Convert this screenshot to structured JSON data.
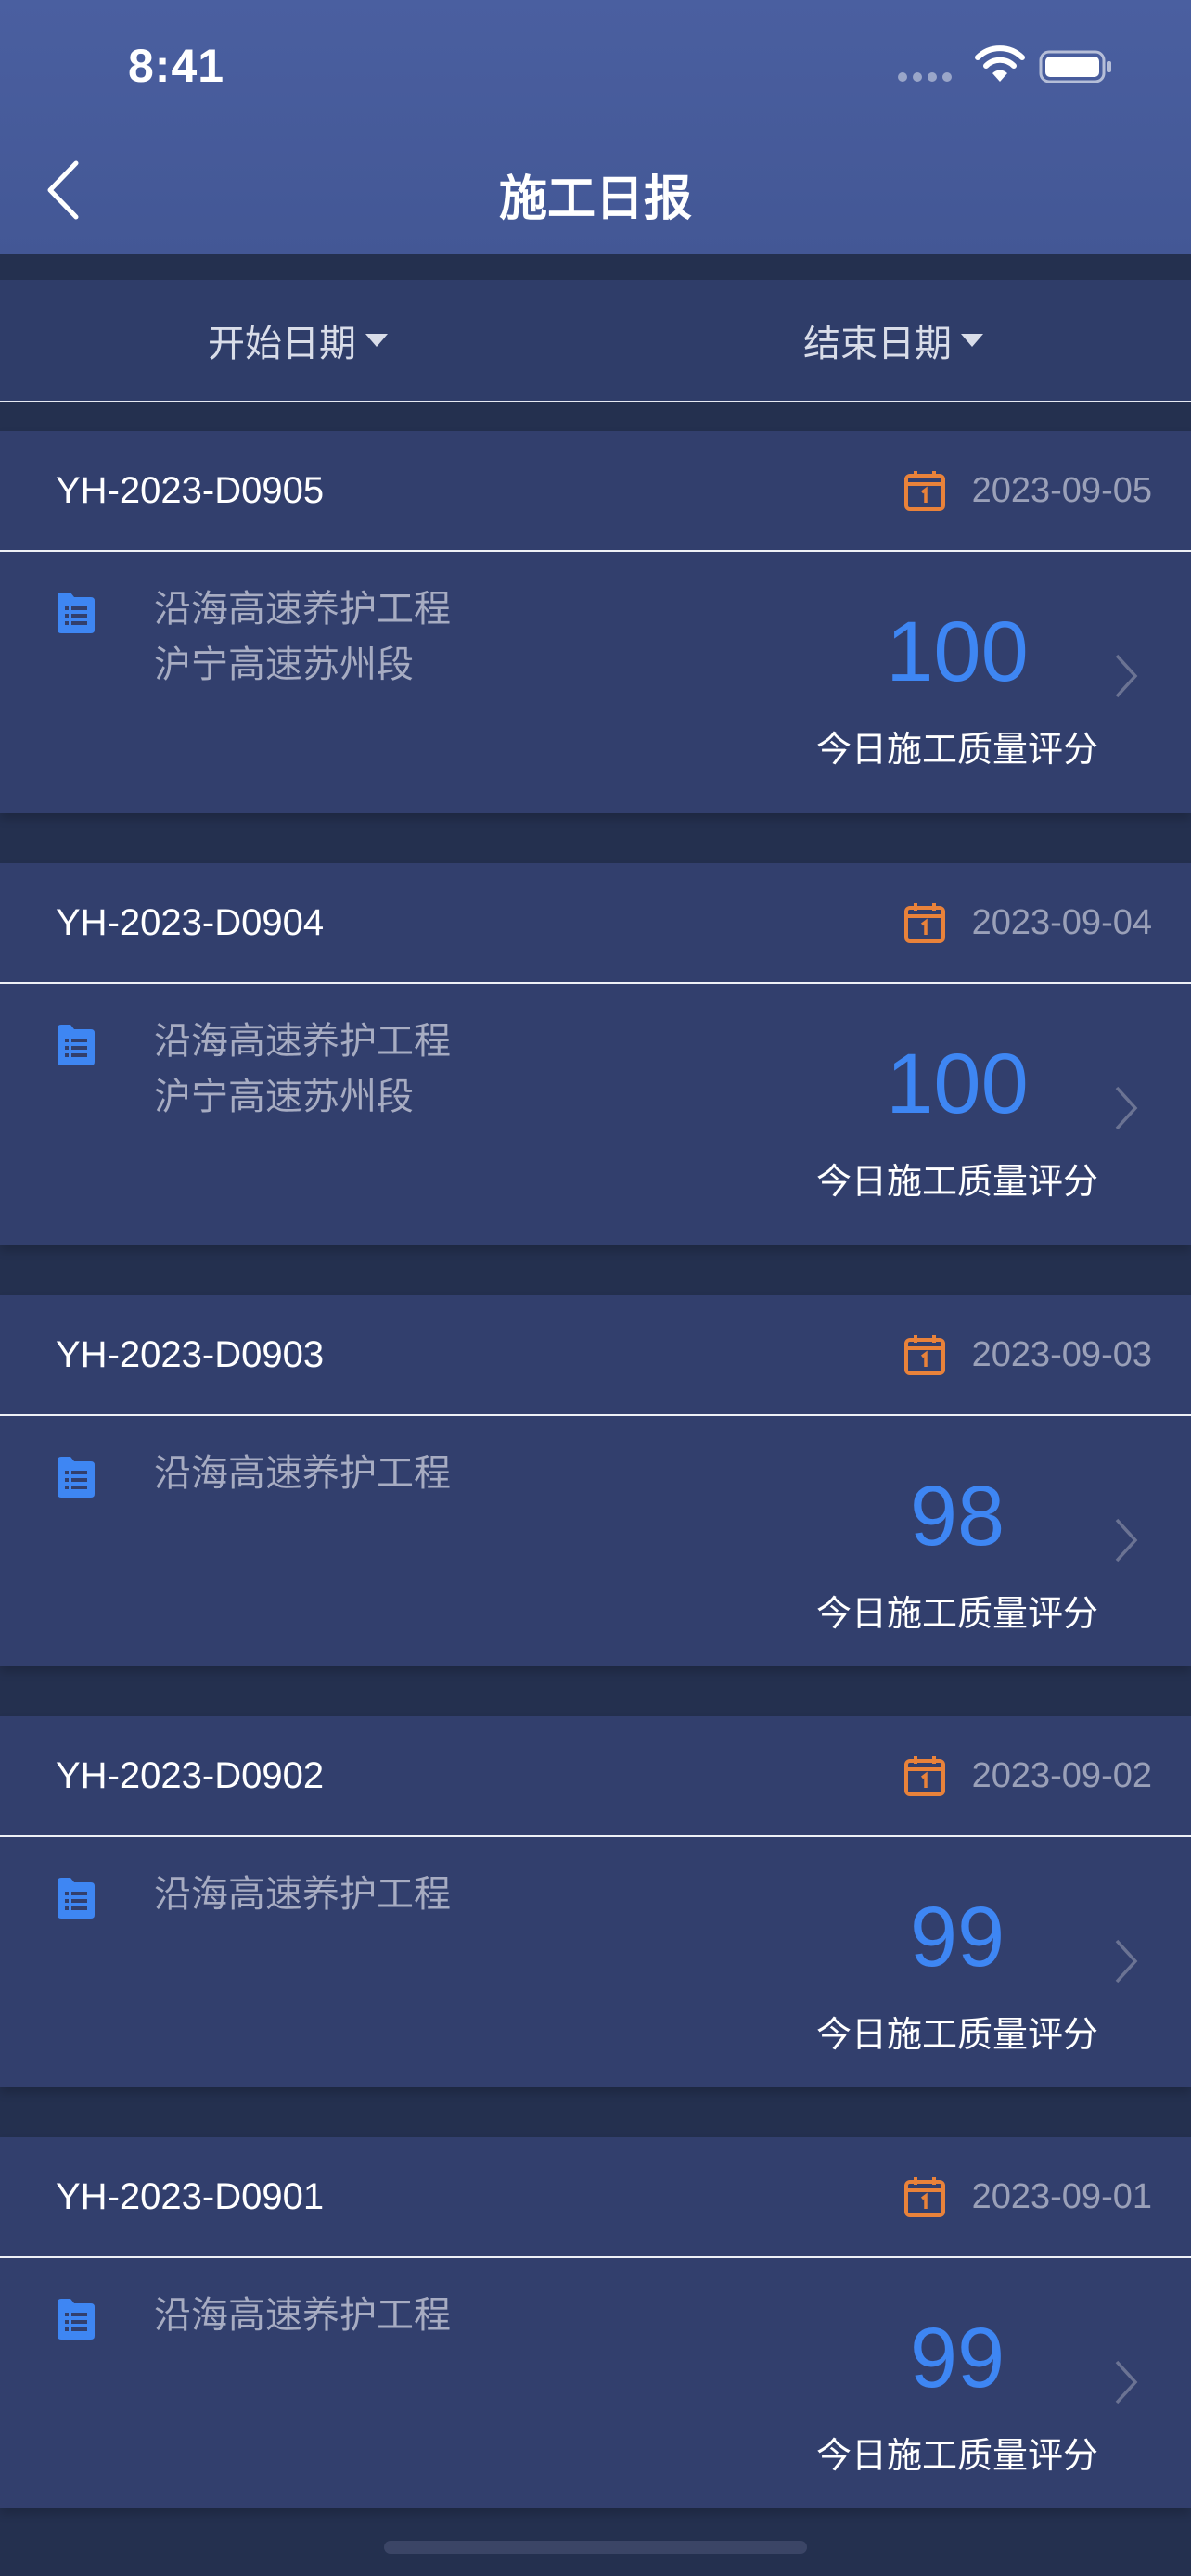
{
  "status_bar": {
    "time": "8:41"
  },
  "nav": {
    "title": "施工日报"
  },
  "filters": {
    "start_label": "开始日期",
    "end_label": "结束日期"
  },
  "colors": {
    "score_blue": "#3e86f3",
    "calendar_orange": "#e9823a",
    "doc_blue": "#3e86f3"
  },
  "reports": [
    {
      "id": "YH-2023-D0905",
      "date": "2023-09-05",
      "line1": "沿海高速养护工程",
      "line2": "沪宁高速苏州段",
      "score": "100",
      "score_label": "今日施工质量评分"
    },
    {
      "id": "YH-2023-D0904",
      "date": "2023-09-04",
      "line1": "沿海高速养护工程",
      "line2": "沪宁高速苏州段",
      "score": "100",
      "score_label": "今日施工质量评分"
    },
    {
      "id": "YH-2023-D0903",
      "date": "2023-09-03",
      "line1": "沿海高速养护工程",
      "line2": "",
      "score": "98",
      "score_label": "今日施工质量评分"
    },
    {
      "id": "YH-2023-D0902",
      "date": "2023-09-02",
      "line1": "沿海高速养护工程",
      "line2": "",
      "score": "99",
      "score_label": "今日施工质量评分"
    },
    {
      "id": "YH-2023-D0901",
      "date": "2023-09-01",
      "line1": "沿海高速养护工程",
      "line2": "",
      "score": "99",
      "score_label": "今日施工质量评分"
    }
  ]
}
